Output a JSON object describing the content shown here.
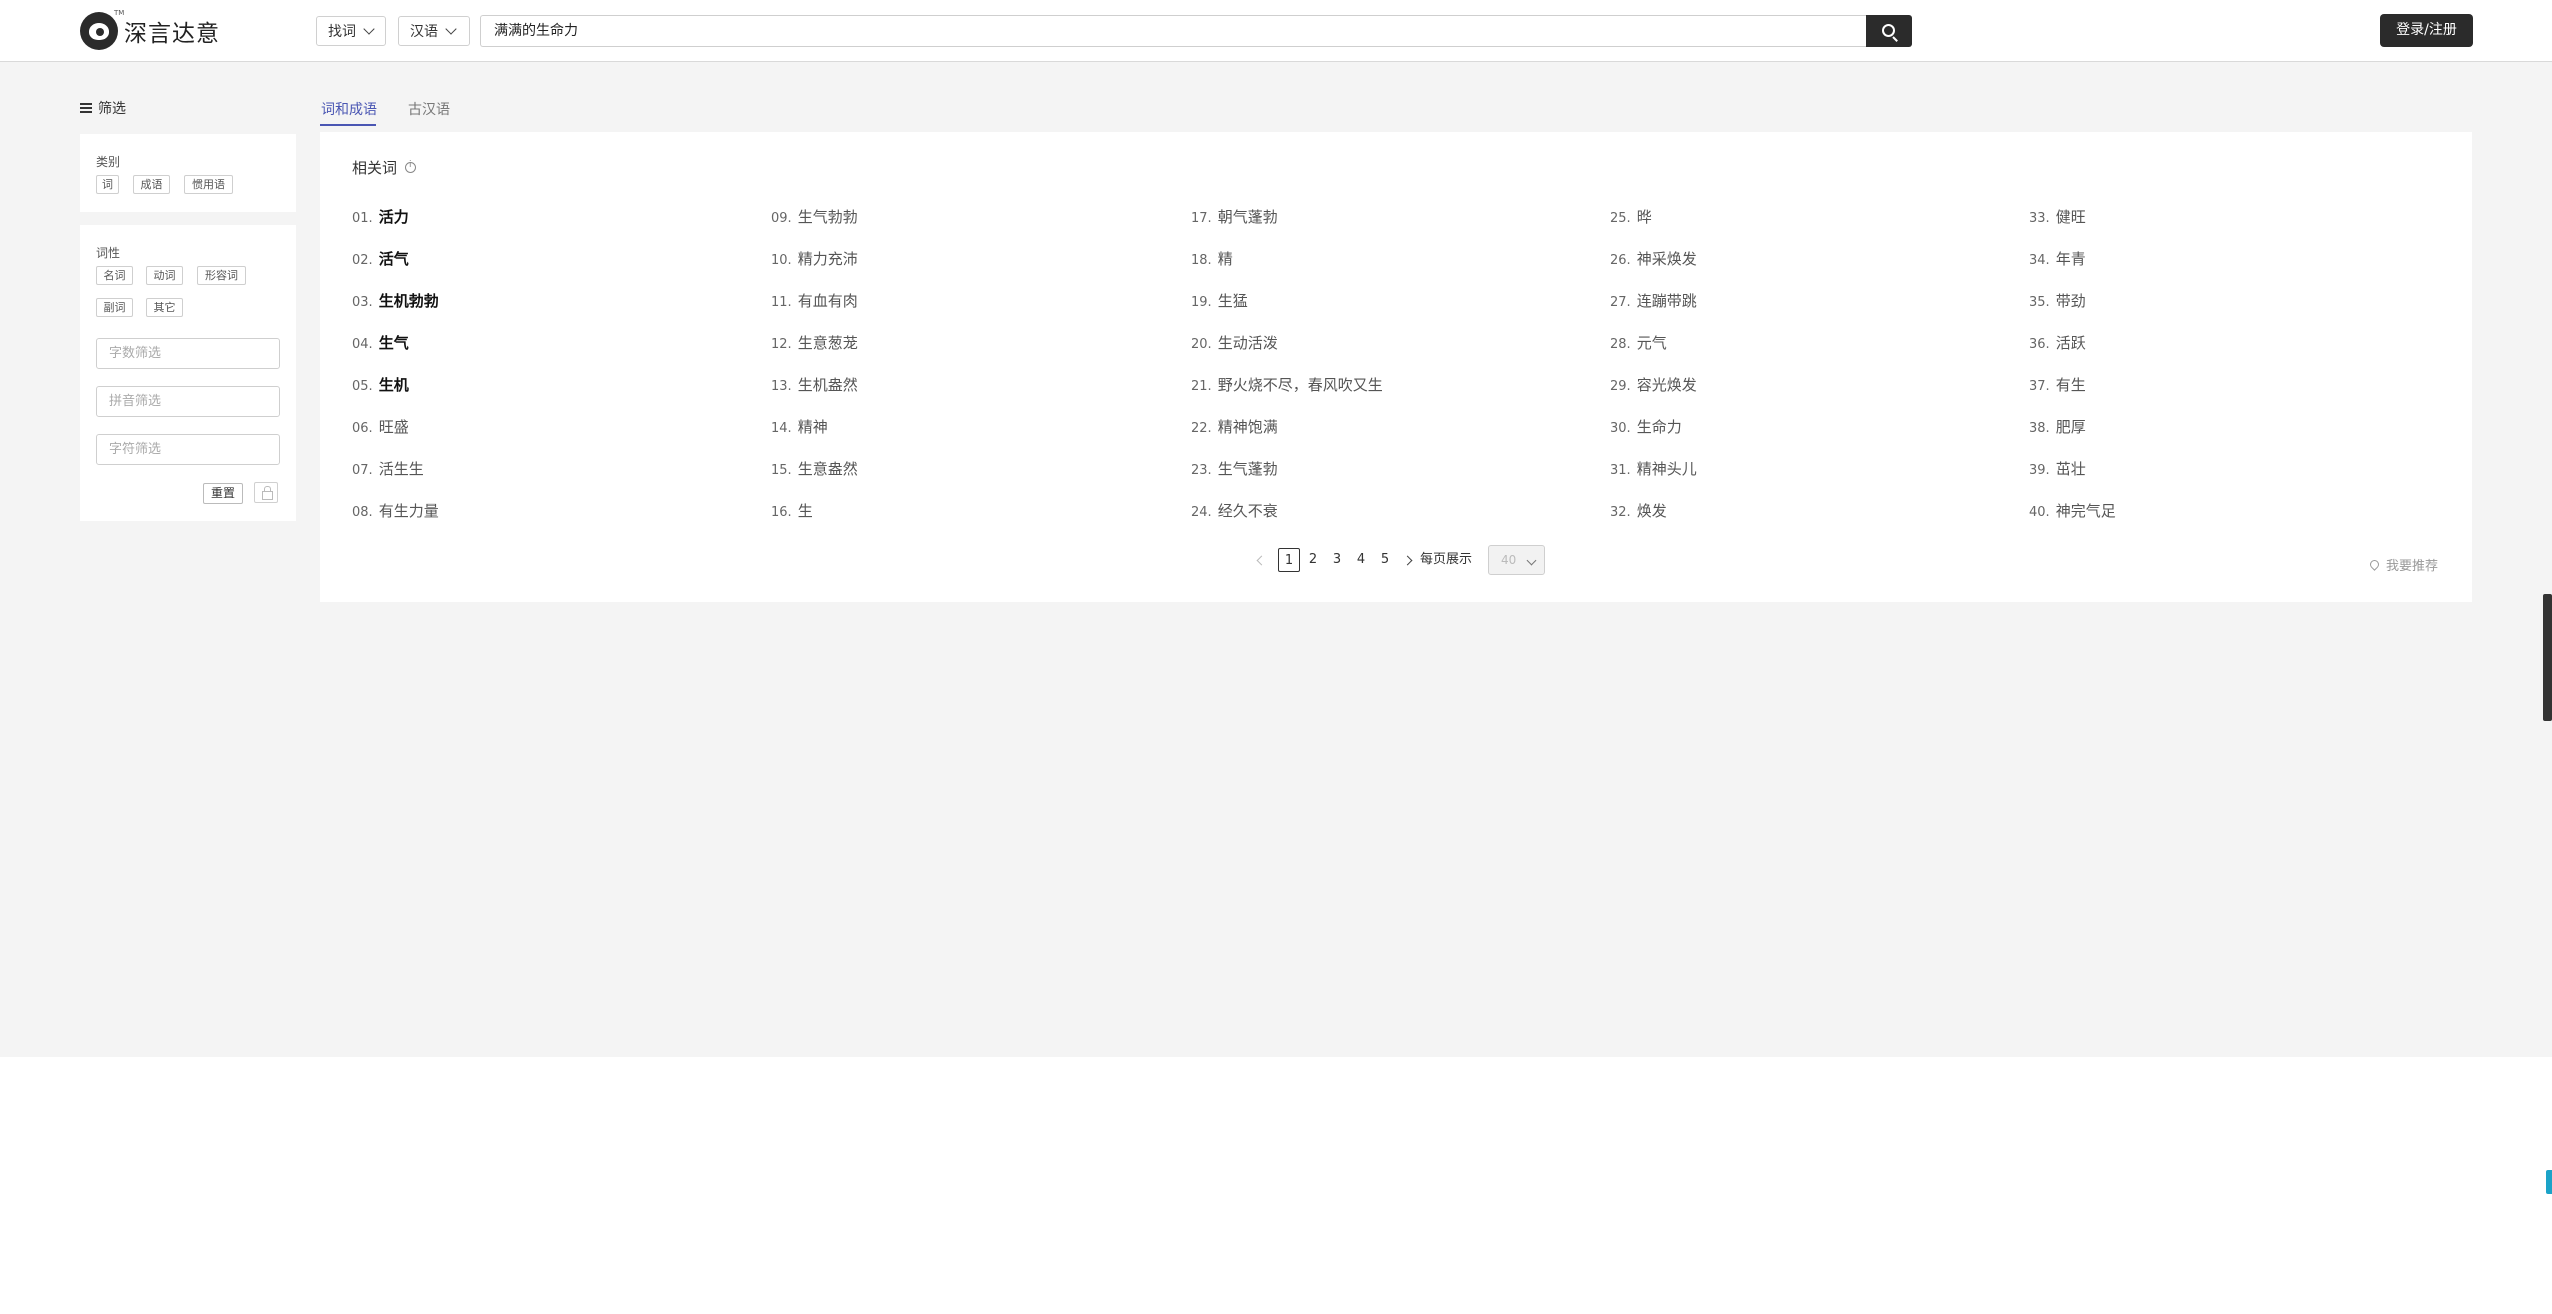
{
  "header": {
    "logo_text": "深言达意",
    "logo_tm": "TM",
    "mode_select": "找词",
    "lang_select": "汉语",
    "search_value": "满满的生命力",
    "login_label": "登录/注册"
  },
  "sidebar": {
    "title": "筛选",
    "category": {
      "label": "类别",
      "options": [
        "词",
        "成语",
        "惯用语"
      ]
    },
    "pos": {
      "label": "词性",
      "options": [
        "名词",
        "动词",
        "形容词",
        "副词",
        "其它"
      ]
    },
    "inputs": {
      "length_placeholder": "字数筛选",
      "pinyin_placeholder": "拼音筛选",
      "char_placeholder": "字符筛选"
    },
    "reset_label": "重置"
  },
  "tabs": [
    {
      "label": "词和成语",
      "active": true
    },
    {
      "label": "古汉语",
      "active": false
    }
  ],
  "results": {
    "section_title": "相关词",
    "words": [
      {
        "num": "01.",
        "text": "活力",
        "strong": true
      },
      {
        "num": "02.",
        "text": "活气",
        "strong": true
      },
      {
        "num": "03.",
        "text": "生机勃勃",
        "strong": true
      },
      {
        "num": "04.",
        "text": "生气",
        "strong": true
      },
      {
        "num": "05.",
        "text": "生机",
        "strong": true
      },
      {
        "num": "06.",
        "text": "旺盛",
        "strong": false
      },
      {
        "num": "07.",
        "text": "活生生",
        "strong": false
      },
      {
        "num": "08.",
        "text": "有生力量",
        "strong": false
      },
      {
        "num": "09.",
        "text": "生气勃勃",
        "strong": false
      },
      {
        "num": "10.",
        "text": "精力充沛",
        "strong": false
      },
      {
        "num": "11.",
        "text": "有血有肉",
        "strong": false
      },
      {
        "num": "12.",
        "text": "生意葱茏",
        "strong": false
      },
      {
        "num": "13.",
        "text": "生机盎然",
        "strong": false
      },
      {
        "num": "14.",
        "text": "精神",
        "strong": false
      },
      {
        "num": "15.",
        "text": "生意盎然",
        "strong": false
      },
      {
        "num": "16.",
        "text": "生",
        "strong": false
      },
      {
        "num": "17.",
        "text": "朝气蓬勃",
        "strong": false
      },
      {
        "num": "18.",
        "text": "精",
        "strong": false
      },
      {
        "num": "19.",
        "text": "生猛",
        "strong": false
      },
      {
        "num": "20.",
        "text": "生动活泼",
        "strong": false
      },
      {
        "num": "21.",
        "text": "野火烧不尽，春风吹又生",
        "strong": false
      },
      {
        "num": "22.",
        "text": "精神饱满",
        "strong": false
      },
      {
        "num": "23.",
        "text": "生气蓬勃",
        "strong": false
      },
      {
        "num": "24.",
        "text": "经久不衰",
        "strong": false
      },
      {
        "num": "25.",
        "text": "晔",
        "strong": false
      },
      {
        "num": "26.",
        "text": "神采焕发",
        "strong": false
      },
      {
        "num": "27.",
        "text": "连蹦带跳",
        "strong": false
      },
      {
        "num": "28.",
        "text": "元气",
        "strong": false
      },
      {
        "num": "29.",
        "text": "容光焕发",
        "strong": false
      },
      {
        "num": "30.",
        "text": "生命力",
        "strong": false
      },
      {
        "num": "31.",
        "text": "精神头儿",
        "strong": false
      },
      {
        "num": "32.",
        "text": "焕发",
        "strong": false
      },
      {
        "num": "33.",
        "text": "健旺",
        "strong": false
      },
      {
        "num": "34.",
        "text": "年青",
        "strong": false
      },
      {
        "num": "35.",
        "text": "带劲",
        "strong": false
      },
      {
        "num": "36.",
        "text": "活跃",
        "strong": false
      },
      {
        "num": "37.",
        "text": "有生",
        "strong": false
      },
      {
        "num": "38.",
        "text": "肥厚",
        "strong": false
      },
      {
        "num": "39.",
        "text": "茁壮",
        "strong": false
      },
      {
        "num": "40.",
        "text": "神完气足",
        "strong": false
      }
    ]
  },
  "pagination": {
    "pages": [
      "1",
      "2",
      "3",
      "4",
      "5"
    ],
    "current": "1",
    "per_page_label": "每页展示",
    "per_page_value": "40"
  },
  "recommend_label": "我要推荐"
}
